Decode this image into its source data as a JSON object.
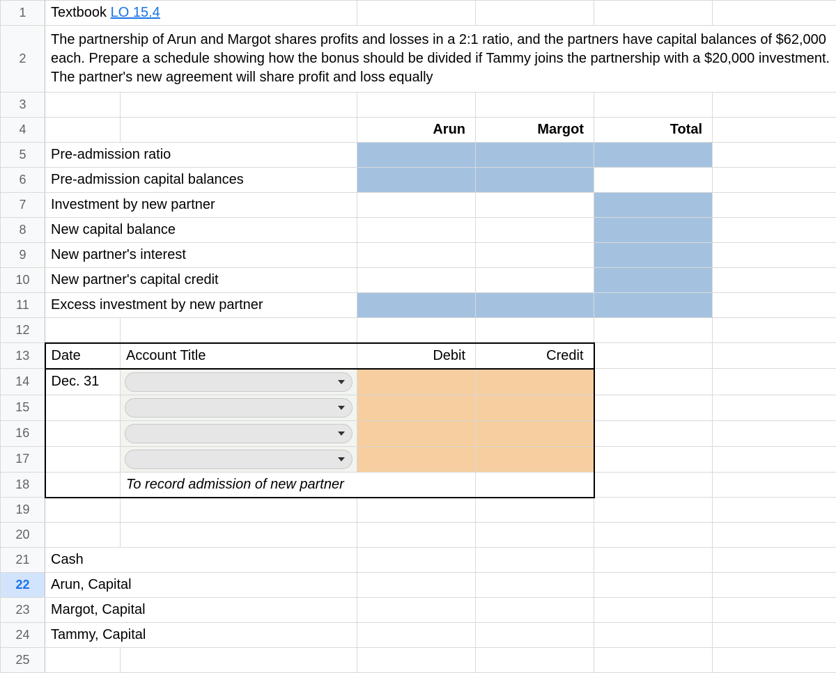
{
  "row1": {
    "textbook": "Textbook",
    "lo_link": "LO 15.4"
  },
  "row2": {
    "problem": "The partnership of Arun and Margot shares profits and losses in a 2:1 ratio, and the partners have capital balances of $62,000 each. Prepare a schedule showing how the bonus should be divided if Tammy joins the partnership with a $20,000 investment. The partner's new agreement will share profit and loss equally"
  },
  "headers": {
    "arun": "Arun",
    "margot": "Margot",
    "total": "Total"
  },
  "labels": {
    "r5": "Pre-admission ratio",
    "r6": "Pre-admission capital balances",
    "r7": "Investment by new partner",
    "r8": "New capital balance",
    "r9": "New partner's interest",
    "r10": "New partner's capital credit",
    "r11": "Excess investment by new partner"
  },
  "journal": {
    "date_hdr": "Date",
    "acct_hdr": "Account Title",
    "debit_hdr": "Debit",
    "credit_hdr": "Credit",
    "date_val": "Dec. 31",
    "memo": "To record admission of new partner"
  },
  "accounts": {
    "r21": "Cash",
    "r22": "Arun, Capital",
    "r23": "Margot, Capital",
    "r24": "Tammy, Capital"
  },
  "rownums": [
    "1",
    "2",
    "3",
    "4",
    "5",
    "6",
    "7",
    "8",
    "9",
    "10",
    "11",
    "12",
    "13",
    "14",
    "15",
    "16",
    "17",
    "18",
    "19",
    "20",
    "21",
    "22",
    "23",
    "24",
    "25"
  ]
}
